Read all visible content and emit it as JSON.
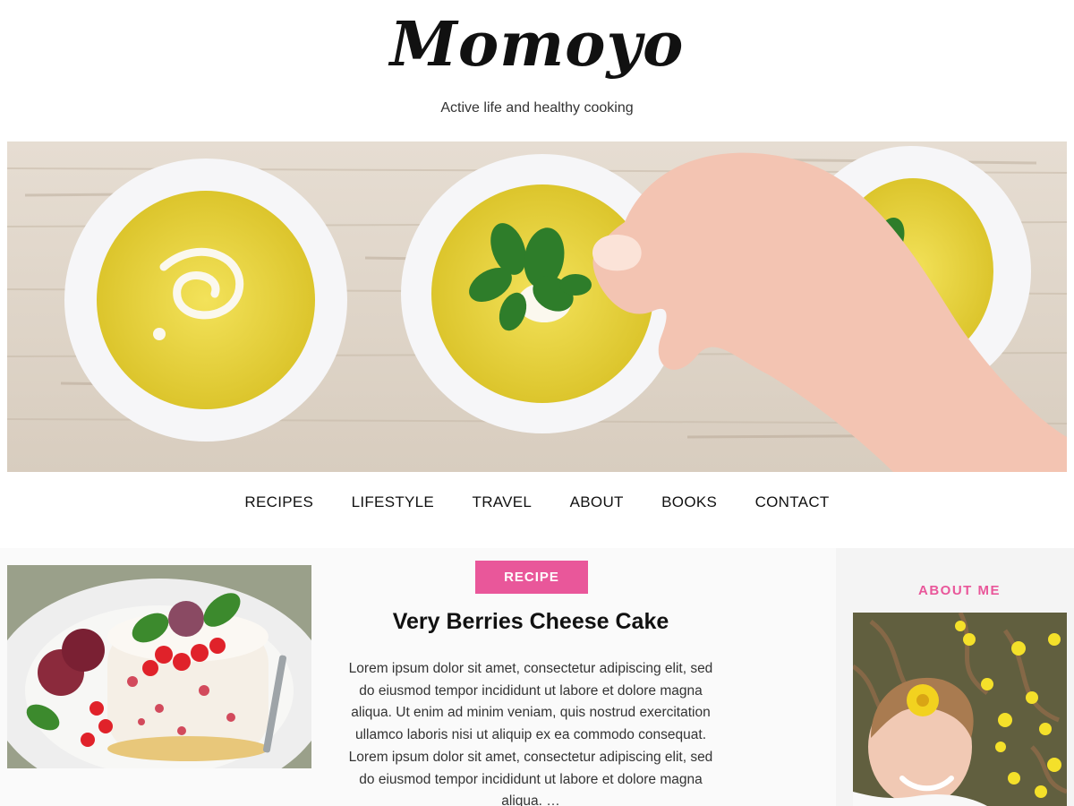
{
  "site": {
    "title": "Momoyo",
    "tagline": "Active life and healthy cooking"
  },
  "nav": {
    "items": [
      "RECIPES",
      "LIFESTYLE",
      "TRAVEL",
      "ABOUT",
      "BOOKS",
      "CONTACT"
    ]
  },
  "post": {
    "category": "RECIPE",
    "title": "Very Berries Cheese Cake",
    "excerpt": "Lorem ipsum dolor sit amet, consectetur adipiscing elit, sed do eiusmod tempor incididunt ut labore et dolore magna aliqua. Ut enim ad minim veniam, quis nostrud exercitation ullamco laboris nisi ut aliquip ex ea commodo consequat. Lorem ipsum dolor sit amet, consectetur adipiscing elit, sed do eiusmod tempor incididunt ut labore et dolore magna aliqua. …"
  },
  "sidebar": {
    "about_title": "ABOUT ME"
  },
  "colors": {
    "accent": "#e9579a",
    "background": "#ffffff",
    "content_background": "#fafafa",
    "text": "#111111"
  }
}
